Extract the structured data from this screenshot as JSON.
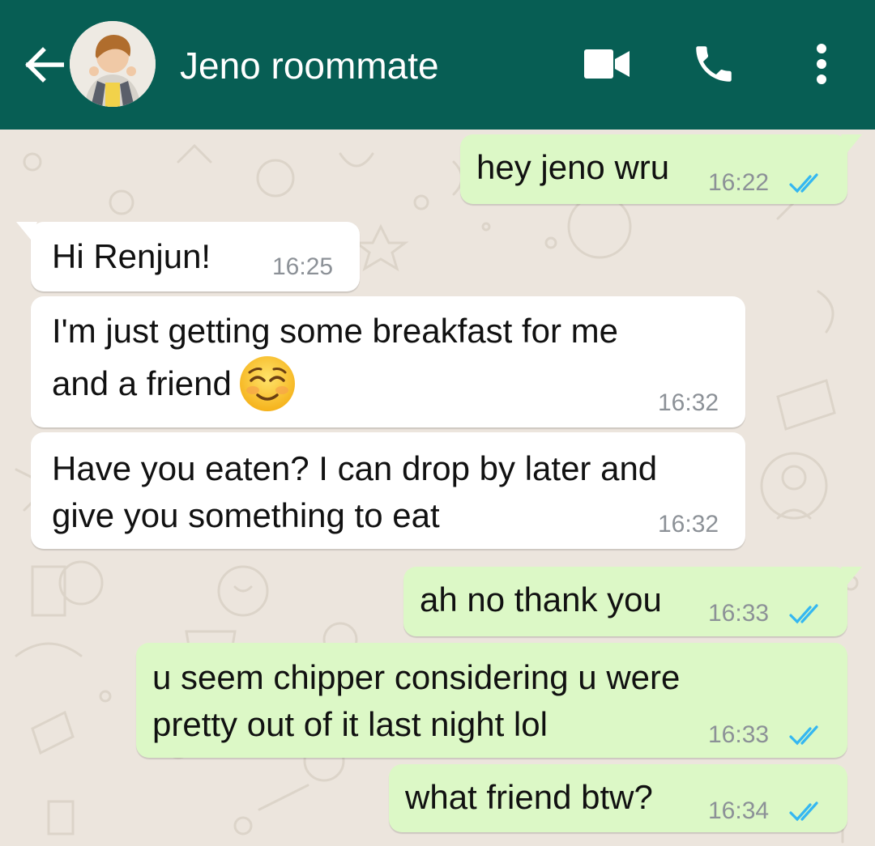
{
  "header": {
    "contact_name": "Jeno roommate",
    "bg_color": "#075E54"
  },
  "icons": {
    "back": "arrow-left-icon",
    "video": "video-camera-icon",
    "call": "phone-icon",
    "menu": "more-vertical-icon",
    "read": "double-check-icon"
  },
  "colors": {
    "outgoing_bubble": "#DCF8C6",
    "incoming_bubble": "#FFFFFF",
    "read_tick": "#34B7F1",
    "wallpaper": "#ECE5DD"
  },
  "messages": [
    {
      "direction": "out",
      "text": "hey jeno wru",
      "time": "16:22",
      "status": "read"
    },
    {
      "direction": "in",
      "text": "Hi Renjun!",
      "time": "16:25"
    },
    {
      "direction": "in",
      "text": "I'm just getting some breakfast for me\nand a friend",
      "emoji": "☺️",
      "time": "16:32"
    },
    {
      "direction": "in",
      "text": "Have you eaten? I can drop by later and\ngive you something to eat",
      "time": "16:32"
    },
    {
      "direction": "out",
      "text": "ah no thank you",
      "time": "16:33",
      "status": "read"
    },
    {
      "direction": "out",
      "text": "u seem chipper considering u were\npretty out of it last night lol",
      "time": "16:33",
      "status": "read"
    },
    {
      "direction": "out",
      "text": "what friend btw?",
      "time": "16:34",
      "status": "read"
    }
  ]
}
